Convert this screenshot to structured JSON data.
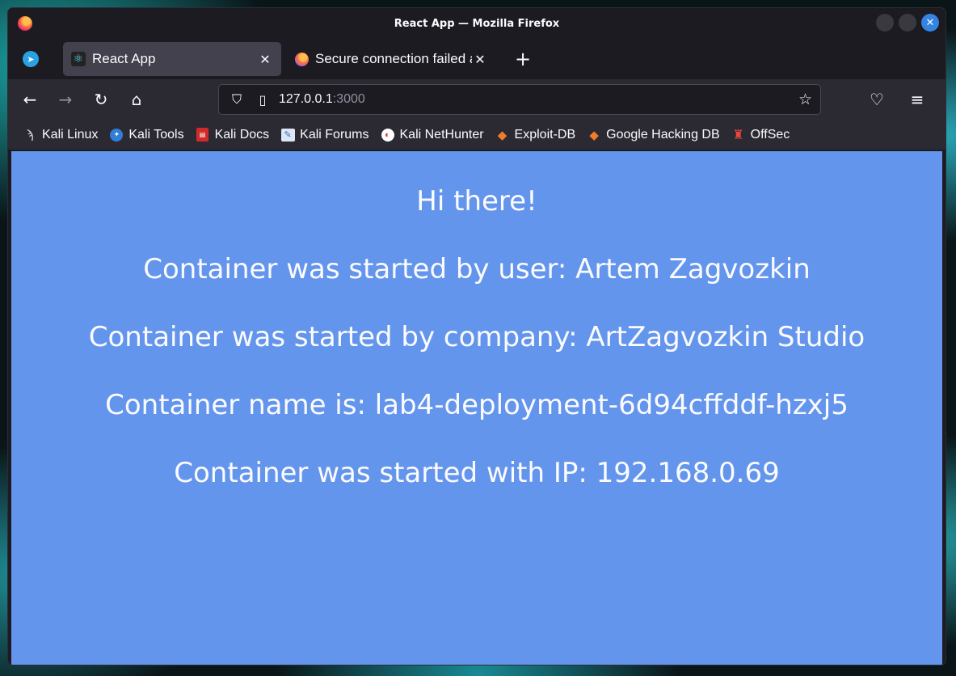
{
  "window": {
    "title": "React App — Mozilla Firefox"
  },
  "tabs": [
    {
      "title": "React App",
      "active": true,
      "icon": "react-icon"
    },
    {
      "title": "Secure connection failed a",
      "active": false,
      "icon": "firefox-icon"
    }
  ],
  "pinned_tab": {
    "icon": "telegram-icon"
  },
  "urlbar": {
    "host": "127.0.0.1",
    "port": ":3000"
  },
  "bookmarks": [
    {
      "label": "Kali Linux",
      "icon": "kali-dragon-icon"
    },
    {
      "label": "Kali Tools",
      "icon": "kali-tools-icon"
    },
    {
      "label": "Kali Docs",
      "icon": "kali-docs-icon"
    },
    {
      "label": "Kali Forums",
      "icon": "kali-forums-icon"
    },
    {
      "label": "Kali NetHunter",
      "icon": "kali-nethunter-icon"
    },
    {
      "label": "Exploit-DB",
      "icon": "exploit-db-icon"
    },
    {
      "label": "Google Hacking DB",
      "icon": "exploit-db-icon"
    },
    {
      "label": "OffSec",
      "icon": "offsec-icon"
    }
  ],
  "page": {
    "background": "#6495ed",
    "lines": [
      "Hi there!",
      "Container was started by user: Artem Zagvozkin",
      "Container was started by company: ArtZagvozkin Studio",
      "Container name is: lab4-deployment-6d94cffddf-hzxj5",
      "Container was started with IP: 192.168.0.69"
    ]
  }
}
